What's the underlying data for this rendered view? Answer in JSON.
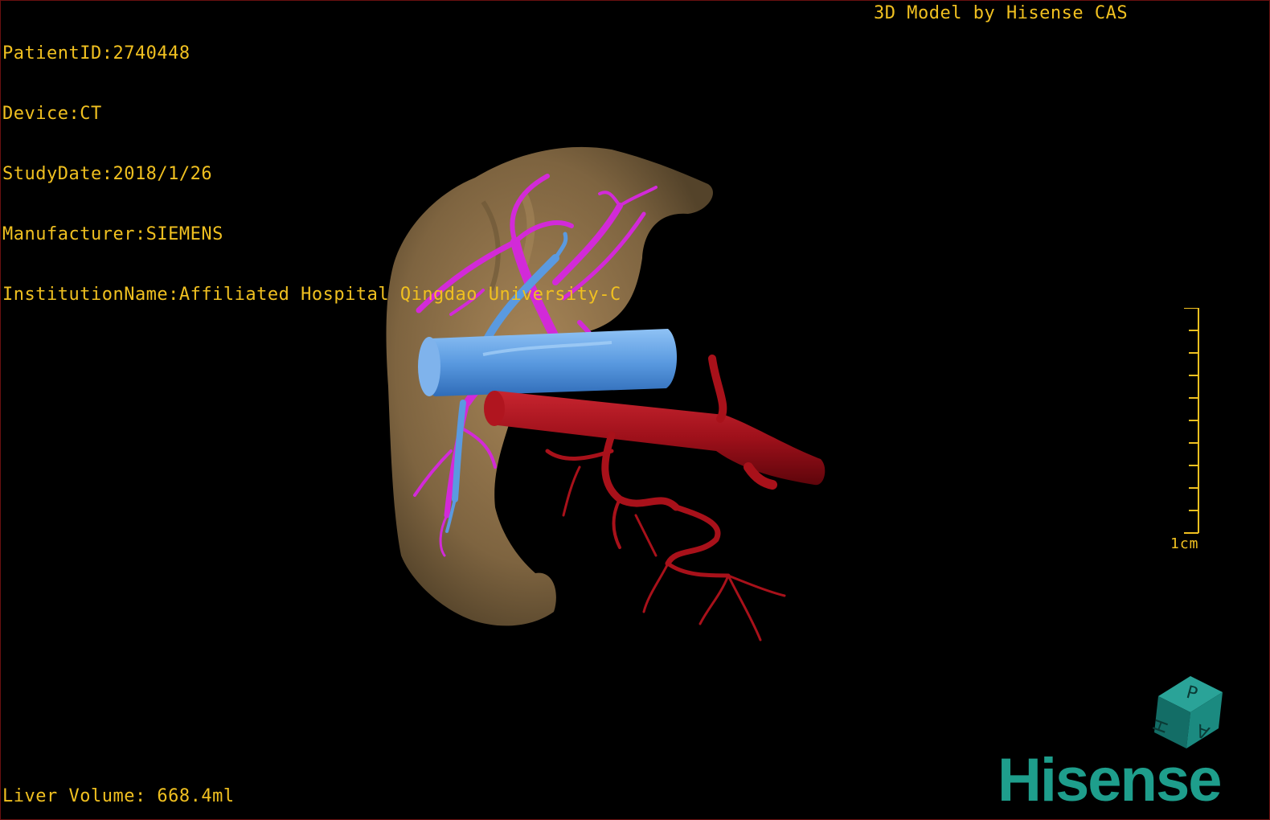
{
  "info": {
    "lines": [
      "PatientID:2740448",
      "Device:CT",
      "StudyDate:2018/1/26",
      "Manufacturer:SIEMENS",
      "InstitutionName:Affiliated Hospital Qingdao University-C"
    ]
  },
  "credit": "3D Model by Hisense CAS",
  "volume": "Liver Volume: 668.4ml",
  "scale": {
    "label": "1cm",
    "ticks": 10
  },
  "cube": {
    "face_top": "P",
    "face_left": "H",
    "face_right": "A"
  },
  "logo": "Hisense",
  "colors": {
    "overlay_text": "#f0c020",
    "liver": "#8a6d45",
    "portal_vein": "#d22ad8",
    "hepatic_vein": "#5a9ae0",
    "artery": "#a8111a",
    "logo": "#1e9e8c",
    "cube": "#1b8a80"
  },
  "icons": {
    "orientation_cube": "orientation-cube-icon",
    "scale_bar": "scale-bar-icon"
  }
}
